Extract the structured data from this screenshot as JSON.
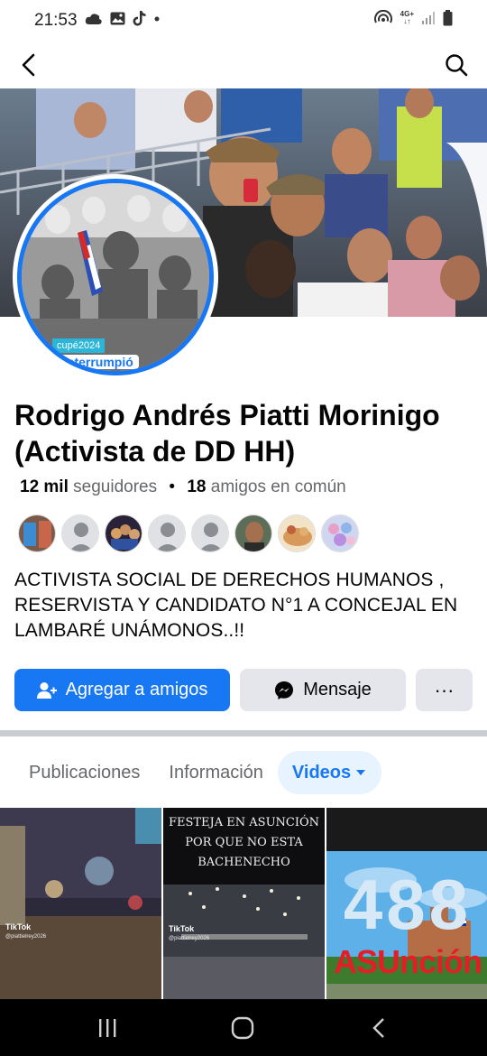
{
  "status_bar": {
    "time": "21:53",
    "network": "4G+"
  },
  "header": {
    "back_icon": "back-arrow-icon",
    "search_icon": "search-icon"
  },
  "avatar": {
    "banner_text": "cupé2024",
    "banner_text2": "interrumpió"
  },
  "profile": {
    "name": "Rodrigo Andrés Piatti Morinigo (Activista de DD HH)",
    "followers_count": "12 mil",
    "followers_label": "seguidores",
    "friends_count": "18",
    "friends_label": "amigos en común",
    "bio": "ACTIVISTA SOCIAL DE DERECHOS HUMANOS , RESERVISTA Y CANDIDATO N°1 A CONCEJAL EN LAMBARÉ UNÁMONOS..!!"
  },
  "actions": {
    "add_friend_label": "Agregar a amigos",
    "message_label": "Mensaje",
    "more_label": "···"
  },
  "tabs": [
    {
      "label": "Publicaciones",
      "active": false
    },
    {
      "label": "Información",
      "active": false
    },
    {
      "label": "Videos",
      "active": true
    }
  ],
  "videos": [
    {
      "badge": "TikTok",
      "user": "@piattielrey2026"
    },
    {
      "badge": "TikTok",
      "user": "@piattielrey2026",
      "caption_line1": "FESTEJA EN ASUNCIÓN",
      "caption_line2": "POR QUE NO ESTA",
      "caption_line3": "BACHENECHO"
    },
    {
      "number": "488",
      "word": "ASUnción"
    }
  ],
  "colors": {
    "accent": "#1877f2",
    "secondary_button": "#e4e6eb",
    "text_muted": "#65676b"
  }
}
